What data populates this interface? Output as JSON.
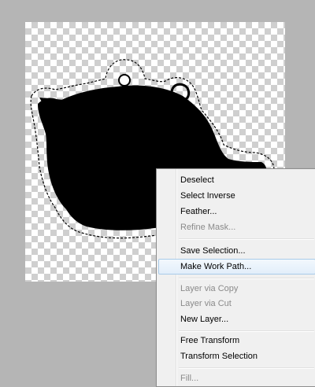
{
  "context_menu": {
    "items": [
      {
        "label": "Deselect",
        "enabled": true
      },
      {
        "label": "Select Inverse",
        "enabled": true
      },
      {
        "label": "Feather...",
        "enabled": true
      },
      {
        "label": "Refine Mask...",
        "enabled": false
      },
      {
        "label": "Save Selection...",
        "enabled": true
      },
      {
        "label": "Make Work Path...",
        "enabled": true,
        "highlighted": true
      },
      {
        "label": "Layer via Copy",
        "enabled": false
      },
      {
        "label": "Layer via Cut",
        "enabled": false
      },
      {
        "label": "New Layer...",
        "enabled": true
      },
      {
        "label": "Free Transform",
        "enabled": true
      },
      {
        "label": "Transform Selection",
        "enabled": true
      },
      {
        "label": "Fill...",
        "enabled": false
      }
    ]
  },
  "colors": {
    "workspace": "#b5b5b5",
    "silhouette": "#000000",
    "menu_bg": "#f0f0f0",
    "highlight_border": "#a9cbe9"
  }
}
